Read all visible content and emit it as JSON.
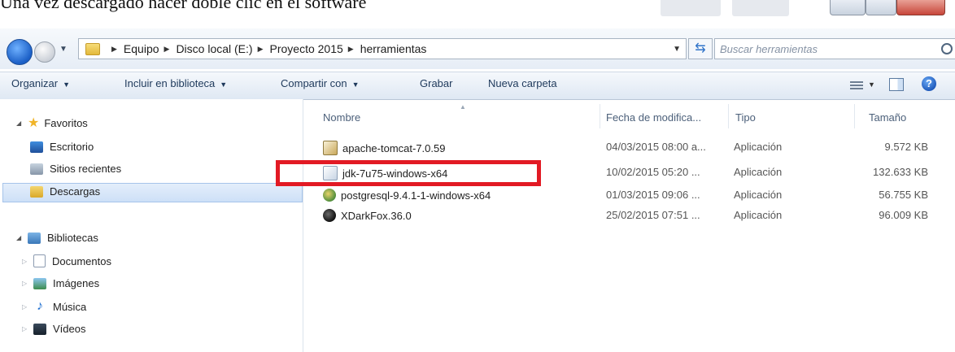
{
  "caption": "Una vez descargado hacer doble clic en el software",
  "address_bar": {
    "breadcrumbs": [
      "Equipo",
      "Disco local (E:)",
      "Proyecto 2015",
      "herramientas"
    ],
    "search_placeholder": "Buscar herramientas"
  },
  "toolbar": {
    "organize": "Organizar",
    "include_library": "Incluir en biblioteca",
    "share_with": "Compartir con",
    "burn": "Grabar",
    "new_folder": "Nueva carpeta",
    "help": "?"
  },
  "nav_pane": {
    "favorites_header": "Favoritos",
    "favorites": [
      "Escritorio",
      "Sitios recientes",
      "Descargas"
    ],
    "selected_favorite": "Descargas",
    "libraries_header": "Bibliotecas",
    "libraries": [
      "Documentos",
      "Imágenes",
      "Música",
      "Vídeos"
    ]
  },
  "file_list": {
    "columns": [
      "Nombre",
      "Fecha de modifica...",
      "Tipo",
      "Tamaño"
    ],
    "rows": [
      {
        "name": "apache-tomcat-7.0.59",
        "date": "04/03/2015 08:00 a...",
        "type": "Aplicación",
        "size": "9.572 KB",
        "icon": "tomcat-installer-icon"
      },
      {
        "name": "jdk-7u75-windows-x64",
        "date": "10/02/2015 05:20 ...",
        "type": "Aplicación",
        "size": "132.633 KB",
        "icon": "java-installer-icon"
      },
      {
        "name": "postgresql-9.4.1-1-windows-x64",
        "date": "01/03/2015 09:06 ...",
        "type": "Aplicación",
        "size": "56.755 KB",
        "icon": "postgresql-installer-icon"
      },
      {
        "name": "XDarkFox.36.0",
        "date": "25/02/2015 07:51 ...",
        "type": "Aplicación",
        "size": "96.009 KB",
        "icon": "browser-installer-icon"
      }
    ],
    "highlighted_row": "jdk-7u75-windows-x64"
  },
  "colors": {
    "highlight_border": "#e21a24",
    "toolbar_text": "#1e395b",
    "selection_bg": "#cde0f7"
  }
}
